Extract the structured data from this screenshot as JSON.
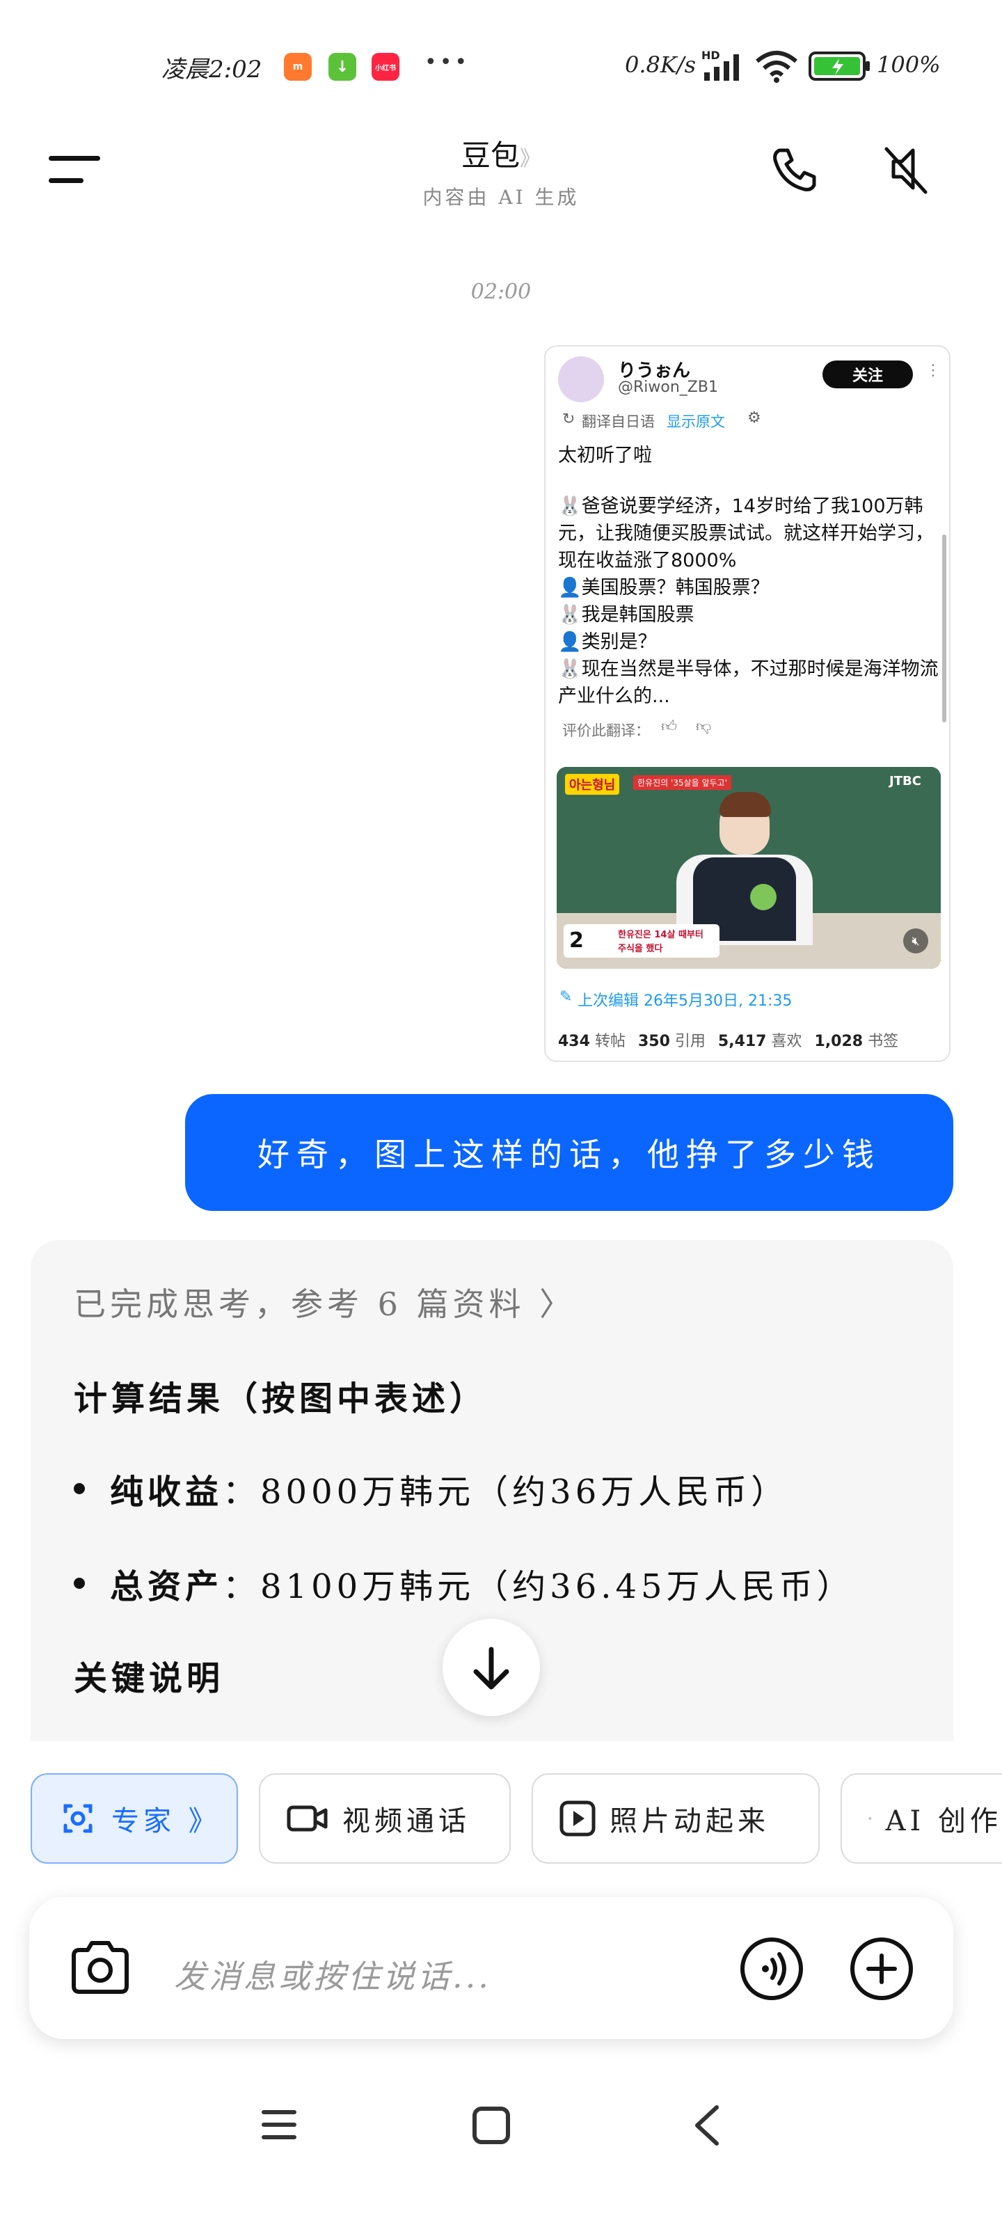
{
  "status_bar": {
    "time": "凌晨2:02",
    "apps": [
      {
        "icon": "shopping-app-icon",
        "label": "m",
        "color": "#ff7a2f"
      },
      {
        "icon": "download-app-icon",
        "label": "↓",
        "color": "#5cc23a"
      },
      {
        "icon": "redbook-app-icon",
        "label": "小红书",
        "color": "#ff2442"
      }
    ],
    "more": "•••",
    "network_speed": "0.8K/s",
    "network_badge": "HD",
    "battery": "100%"
  },
  "header": {
    "title": "豆包",
    "title_chevron": "》",
    "subtitle": "内容由 AI 生成",
    "menu_icon": "menu-icon",
    "call_icon": "phone-icon",
    "mute_icon": "speaker-muted-icon"
  },
  "chat": {
    "timestamp": "02:00",
    "tweet": {
      "display_name": "りうぉん",
      "handle": "@Riwon_ZB1",
      "follow_label": "关注",
      "translated_from": "翻译自日语",
      "show_original": "显示原文",
      "body_title": "太初听了啦",
      "body": "🐰爸爸说要学经济，14岁时给了我100万韩元，让我随便买股票试试。就这样开始学习，现在收益涨了8000%\n👤美国股票？韩国股票？\n🐰我是韩国股票\n👤类别是？\n🐰现在当然是半导体，不过那时候是海洋物流产业什么的...",
      "rate_translation": "评价此翻译：",
      "video": {
        "show_tag": "아는형님",
        "show_subtitle": "한유진의 '35살을 앞두고'",
        "network_logo": "JTBC",
        "caption_number": "2",
        "caption_line1": "한유진은 14살 때부터",
        "caption_line2": "주식을 했다"
      },
      "edited": "上次编辑 26年5月30日, 21:35",
      "stats": [
        {
          "num": "434",
          "label": "转帖"
        },
        {
          "num": "350",
          "label": "引用"
        },
        {
          "num": "5,417",
          "label": "喜欢"
        },
        {
          "num": "1,028",
          "label": "书签"
        }
      ]
    },
    "user_message": "好奇，图上这样的话，他挣了多少钱",
    "ai": {
      "thinking": "已完成思考，参考 6 篇资料 〉",
      "heading": "计算结果（按图中表述）",
      "bullets": [
        {
          "label": "纯收益",
          "value": "：8000万韩元（约36万人民币）"
        },
        {
          "label": "总资产",
          "value": "：8100万韩元（约36.45万人民币）"
        }
      ],
      "section": "关键说明"
    }
  },
  "chips": [
    {
      "label": "专家 》",
      "icon": "expert-icon"
    },
    {
      "label": "视频通话",
      "icon": "video-call-icon"
    },
    {
      "label": "照片动起来",
      "icon": "play-photo-icon"
    },
    {
      "label": "AI 创作",
      "icon": "sparkle-icon"
    }
  ],
  "input": {
    "placeholder": "发消息或按住说话..."
  },
  "nav": {
    "recents": "recents-icon",
    "home": "home-icon",
    "back": "back-icon"
  },
  "colors": {
    "accent": "#0a66ff",
    "chip_active_bg": "#e8f1ff",
    "panel_bg": "#f6f6f6"
  }
}
